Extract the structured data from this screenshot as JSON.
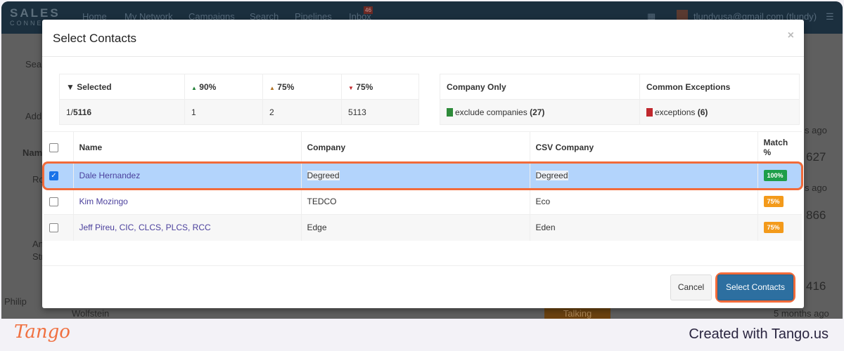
{
  "app": {
    "logo": "SALES",
    "logo_sub": "CONNECT",
    "nav": [
      "Home",
      "My Network",
      "Campaigns",
      "Search",
      "Pipelines",
      "Inbox"
    ],
    "inbox_badge": "46",
    "user": "tlundyusa@gmail.com (tlundy)",
    "bg_left": [
      "Sear",
      "Add",
      "Name",
      "Ro",
      "An",
      "Str",
      "Philip",
      "Wolfstein"
    ],
    "bg_right": [
      "627",
      "866",
      "416"
    ],
    "bg_ago": [
      "s ago",
      "s ago",
      "5 months ago"
    ],
    "bg_status": "Talking"
  },
  "modal": {
    "title": "Select Contacts",
    "close": "×",
    "summary": {
      "headers": [
        "Selected",
        "90%",
        "75%",
        "75%"
      ],
      "selected_count": "1/",
      "selected_total": "5116",
      "values": [
        "1",
        "2",
        "5113"
      ]
    },
    "csv": {
      "headers": [
        "Company Only",
        "Common Exceptions"
      ],
      "company_label": "exclude companies",
      "company_count": "(27)",
      "exceptions_label": "exceptions",
      "exceptions_count": "(6)"
    },
    "table": {
      "headers": [
        "Name",
        "Company",
        "CSV Company",
        "Match %"
      ],
      "rows": [
        {
          "name": "Dale Hernandez",
          "company": "Degreed",
          "csv_company": "Degreed",
          "match": "100%",
          "checked": true,
          "color": "#1e9e4a"
        },
        {
          "name": "Kim Mozingo",
          "company": "TEDCO",
          "csv_company": "Eco",
          "match": "75%",
          "checked": false,
          "color": "#f39a1b"
        },
        {
          "name": "Jeff Pireu, CIC, CLCS, PLCS, RCC",
          "company": "Edge",
          "csv_company": "Eden",
          "match": "75%",
          "checked": false,
          "color": "#f39a1b"
        }
      ]
    },
    "cancel": "Cancel",
    "select": "Select Contacts"
  },
  "footer": {
    "brand": "Tango",
    "created": "Created with Tango.us"
  }
}
